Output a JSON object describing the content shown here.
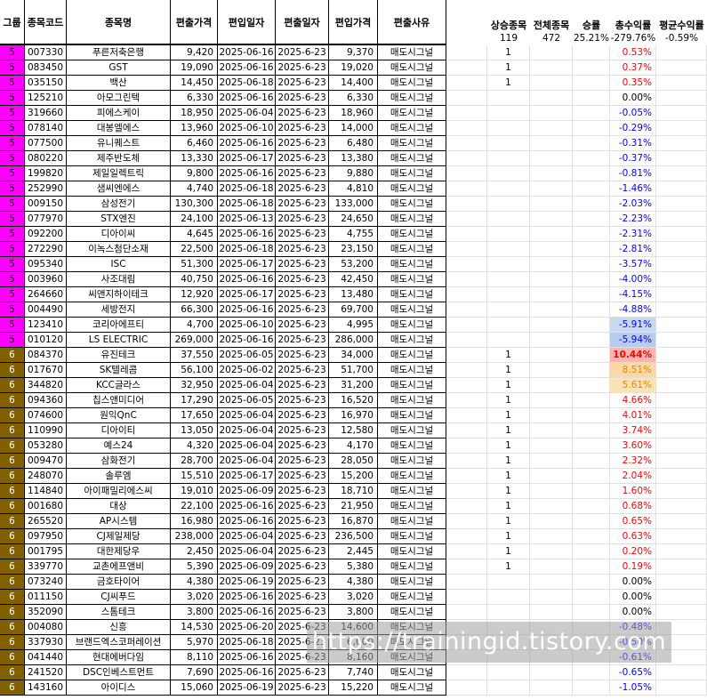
{
  "headers": [
    "그룹",
    "종목코드",
    "종목명",
    "편출가격",
    "편입일자",
    "편출일자",
    "편입가격",
    "편출사유"
  ],
  "summary": {
    "labels": [
      "상승종목",
      "전체종목",
      "승률",
      "총수익률",
      "평균수익률"
    ],
    "values": [
      "119",
      "472",
      "25.21%",
      "-279.76%",
      "-0.59%"
    ]
  },
  "colors": {
    "group5": "#ff00ff",
    "group6": "#806000",
    "negative": "#0000ff",
    "positive": "#ff0000"
  },
  "rows": [
    {
      "group": "5",
      "code": "007330",
      "name": "푸른저축은행",
      "out_price": "9,420",
      "in_date": "2025-06-16",
      "out_date": "2025-6-23",
      "in_price": "9,370",
      "reason": "매도시그널",
      "up": "1",
      "ret": "0.53%"
    },
    {
      "group": "5",
      "code": "083450",
      "name": "GST",
      "out_price": "19,090",
      "in_date": "2025-06-16",
      "out_date": "2025-6-23",
      "in_price": "19,020",
      "reason": "매도시그널",
      "up": "1",
      "ret": "0.37%"
    },
    {
      "group": "5",
      "code": "035150",
      "name": "백산",
      "out_price": "14,450",
      "in_date": "2025-06-18",
      "out_date": "2025-6-23",
      "in_price": "14,400",
      "reason": "매도시그널",
      "up": "1",
      "ret": "0.35%"
    },
    {
      "group": "5",
      "code": "125210",
      "name": "아모그린텍",
      "out_price": "6,330",
      "in_date": "2025-06-16",
      "out_date": "2025-6-23",
      "in_price": "6,330",
      "reason": "매도시그널",
      "up": "",
      "ret": "0.00%"
    },
    {
      "group": "5",
      "code": "319660",
      "name": "피에스케이",
      "out_price": "18,950",
      "in_date": "2025-06-04",
      "out_date": "2025-6-23",
      "in_price": "18,960",
      "reason": "매도시그널",
      "up": "",
      "ret": "-0.05%"
    },
    {
      "group": "5",
      "code": "078140",
      "name": "대봉엘에스",
      "out_price": "13,960",
      "in_date": "2025-06-10",
      "out_date": "2025-6-23",
      "in_price": "14,000",
      "reason": "매도시그널",
      "up": "",
      "ret": "-0.29%"
    },
    {
      "group": "5",
      "code": "077500",
      "name": "유니퀘스트",
      "out_price": "6,460",
      "in_date": "2025-06-16",
      "out_date": "2025-6-23",
      "in_price": "6,480",
      "reason": "매도시그널",
      "up": "",
      "ret": "-0.31%"
    },
    {
      "group": "5",
      "code": "080220",
      "name": "제주반도체",
      "out_price": "13,330",
      "in_date": "2025-06-17",
      "out_date": "2025-6-23",
      "in_price": "13,380",
      "reason": "매도시그널",
      "up": "",
      "ret": "-0.37%"
    },
    {
      "group": "5",
      "code": "199820",
      "name": "제일일렉트릭",
      "out_price": "9,800",
      "in_date": "2025-06-16",
      "out_date": "2025-6-23",
      "in_price": "9,880",
      "reason": "매도시그널",
      "up": "",
      "ret": "-0.81%"
    },
    {
      "group": "5",
      "code": "252990",
      "name": "샘씨엔에스",
      "out_price": "4,740",
      "in_date": "2025-06-18",
      "out_date": "2025-6-23",
      "in_price": "4,810",
      "reason": "매도시그널",
      "up": "",
      "ret": "-1.46%"
    },
    {
      "group": "5",
      "code": "009150",
      "name": "삼성전기",
      "out_price": "130,300",
      "in_date": "2025-06-18",
      "out_date": "2025-6-23",
      "in_price": "133,000",
      "reason": "매도시그널",
      "up": "",
      "ret": "-2.03%"
    },
    {
      "group": "5",
      "code": "077970",
      "name": "STX엔진",
      "out_price": "24,100",
      "in_date": "2025-06-13",
      "out_date": "2025-6-23",
      "in_price": "24,650",
      "reason": "매도시그널",
      "up": "",
      "ret": "-2.23%"
    },
    {
      "group": "5",
      "code": "092200",
      "name": "디아이씨",
      "out_price": "4,645",
      "in_date": "2025-06-16",
      "out_date": "2025-6-23",
      "in_price": "4,755",
      "reason": "매도시그널",
      "up": "",
      "ret": "-2.31%"
    },
    {
      "group": "5",
      "code": "272290",
      "name": "이녹스첨단소재",
      "out_price": "22,500",
      "in_date": "2025-06-18",
      "out_date": "2025-6-23",
      "in_price": "23,150",
      "reason": "매도시그널",
      "up": "",
      "ret": "-2.81%"
    },
    {
      "group": "5",
      "code": "095340",
      "name": "ISC",
      "out_price": "51,300",
      "in_date": "2025-06-17",
      "out_date": "2025-6-23",
      "in_price": "53,200",
      "reason": "매도시그널",
      "up": "",
      "ret": "-3.57%"
    },
    {
      "group": "5",
      "code": "003960",
      "name": "사조대림",
      "out_price": "40,750",
      "in_date": "2025-06-16",
      "out_date": "2025-6-23",
      "in_price": "42,450",
      "reason": "매도시그널",
      "up": "",
      "ret": "-4.00%"
    },
    {
      "group": "5",
      "code": "264660",
      "name": "씨앤지하이테크",
      "out_price": "12,920",
      "in_date": "2025-06-17",
      "out_date": "2025-6-23",
      "in_price": "13,480",
      "reason": "매도시그널",
      "up": "",
      "ret": "-4.15%"
    },
    {
      "group": "5",
      "code": "004490",
      "name": "세방전지",
      "out_price": "66,300",
      "in_date": "2025-06-16",
      "out_date": "2025-6-23",
      "in_price": "69,700",
      "reason": "매도시그널",
      "up": "",
      "ret": "-4.88%"
    },
    {
      "group": "5",
      "code": "123410",
      "name": "코리아에프티",
      "out_price": "4,700",
      "in_date": "2025-06-10",
      "out_date": "2025-6-23",
      "in_price": "4,995",
      "reason": "매도시그널",
      "up": "",
      "ret": "-5.91%",
      "hl": "#c9d9f2"
    },
    {
      "group": "5",
      "code": "010120",
      "name": "LS ELECTRIC",
      "out_price": "269,000",
      "in_date": "2025-06-16",
      "out_date": "2025-6-23",
      "in_price": "286,000",
      "reason": "매도시그널",
      "up": "",
      "ret": "-5.94%",
      "hl": "#b8cdee"
    },
    {
      "group": "6",
      "code": "084370",
      "name": "유진테크",
      "out_price": "37,550",
      "in_date": "2025-06-05",
      "out_date": "2025-6-23",
      "in_price": "34,000",
      "reason": "매도시그널",
      "up": "1",
      "ret": "10.44%",
      "hl": "#f8b7b3",
      "bold": true
    },
    {
      "group": "6",
      "code": "017670",
      "name": "SK텔레콤",
      "out_price": "56,100",
      "in_date": "2025-06-02",
      "out_date": "2025-6-23",
      "in_price": "51,700",
      "reason": "매도시그널",
      "up": "1",
      "ret": "8.51%",
      "hl": "#fbd9a6",
      "orange": true
    },
    {
      "group": "6",
      "code": "344820",
      "name": "KCC글라스",
      "out_price": "32,950",
      "in_date": "2025-06-04",
      "out_date": "2025-6-23",
      "in_price": "31,200",
      "reason": "매도시그널",
      "up": "1",
      "ret": "5.61%",
      "hl": "#fde2b6",
      "orange": true
    },
    {
      "group": "6",
      "code": "094360",
      "name": "칩스앤미디어",
      "out_price": "17,290",
      "in_date": "2025-06-05",
      "out_date": "2025-6-23",
      "in_price": "16,520",
      "reason": "매도시그널",
      "up": "1",
      "ret": "4.66%"
    },
    {
      "group": "6",
      "code": "074600",
      "name": "원익QnC",
      "out_price": "17,650",
      "in_date": "2025-06-04",
      "out_date": "2025-6-23",
      "in_price": "16,970",
      "reason": "매도시그널",
      "up": "1",
      "ret": "4.01%"
    },
    {
      "group": "6",
      "code": "110990",
      "name": "디아이티",
      "out_price": "13,050",
      "in_date": "2025-06-04",
      "out_date": "2025-6-23",
      "in_price": "12,580",
      "reason": "매도시그널",
      "up": "1",
      "ret": "3.74%"
    },
    {
      "group": "6",
      "code": "053280",
      "name": "예스24",
      "out_price": "4,320",
      "in_date": "2025-06-04",
      "out_date": "2025-6-23",
      "in_price": "4,170",
      "reason": "매도시그널",
      "up": "1",
      "ret": "3.60%"
    },
    {
      "group": "6",
      "code": "009470",
      "name": "삼화전기",
      "out_price": "28,700",
      "in_date": "2025-06-04",
      "out_date": "2025-6-23",
      "in_price": "28,050",
      "reason": "매도시그널",
      "up": "1",
      "ret": "2.32%"
    },
    {
      "group": "6",
      "code": "248070",
      "name": "솔루엠",
      "out_price": "15,510",
      "in_date": "2025-06-17",
      "out_date": "2025-6-23",
      "in_price": "15,200",
      "reason": "매도시그널",
      "up": "1",
      "ret": "2.04%"
    },
    {
      "group": "6",
      "code": "114840",
      "name": "아이패밀리에스씨",
      "out_price": "19,010",
      "in_date": "2025-06-09",
      "out_date": "2025-6-23",
      "in_price": "18,710",
      "reason": "매도시그널",
      "up": "1",
      "ret": "1.60%"
    },
    {
      "group": "6",
      "code": "001680",
      "name": "대상",
      "out_price": "22,100",
      "in_date": "2025-06-16",
      "out_date": "2025-6-23",
      "in_price": "21,950",
      "reason": "매도시그널",
      "up": "1",
      "ret": "0.68%"
    },
    {
      "group": "6",
      "code": "265520",
      "name": "AP시스템",
      "out_price": "16,980",
      "in_date": "2025-06-16",
      "out_date": "2025-6-23",
      "in_price": "16,870",
      "reason": "매도시그널",
      "up": "1",
      "ret": "0.65%"
    },
    {
      "group": "6",
      "code": "097950",
      "name": "CJ제일제당",
      "out_price": "238,000",
      "in_date": "2025-06-04",
      "out_date": "2025-6-23",
      "in_price": "236,500",
      "reason": "매도시그널",
      "up": "1",
      "ret": "0.63%"
    },
    {
      "group": "6",
      "code": "001795",
      "name": "대한제당우",
      "out_price": "2,450",
      "in_date": "2025-06-04",
      "out_date": "2025-6-23",
      "in_price": "2,445",
      "reason": "매도시그널",
      "up": "1",
      "ret": "0.20%"
    },
    {
      "group": "6",
      "code": "339770",
      "name": "교촌에프앤비",
      "out_price": "5,390",
      "in_date": "2025-06-09",
      "out_date": "2025-6-23",
      "in_price": "5,380",
      "reason": "매도시그널",
      "up": "1",
      "ret": "0.19%"
    },
    {
      "group": "6",
      "code": "073240",
      "name": "금호타이어",
      "out_price": "4,380",
      "in_date": "2025-06-19",
      "out_date": "2025-6-23",
      "in_price": "4,380",
      "reason": "매도시그널",
      "up": "",
      "ret": "0.00%"
    },
    {
      "group": "6",
      "code": "011150",
      "name": "CJ씨푸드",
      "out_price": "3,020",
      "in_date": "2025-06-16",
      "out_date": "2025-6-23",
      "in_price": "3,020",
      "reason": "매도시그널",
      "up": "",
      "ret": "0.00%"
    },
    {
      "group": "6",
      "code": "352090",
      "name": "스톰테크",
      "out_price": "3,800",
      "in_date": "2025-06-16",
      "out_date": "2025-6-23",
      "in_price": "3,800",
      "reason": "매도시그널",
      "up": "",
      "ret": "0.00%"
    },
    {
      "group": "6",
      "code": "004080",
      "name": "신흥",
      "out_price": "14,530",
      "in_date": "2025-06-20",
      "out_date": "2025-6-23",
      "in_price": "14,600",
      "reason": "매도시그널",
      "up": "",
      "ret": "-0.48%"
    },
    {
      "group": "6",
      "code": "337930",
      "name": "브랜드엑스코퍼레이션",
      "out_price": "5,970",
      "in_date": "2025-06-18",
      "out_date": "2025-6-23",
      "in_price": "6,000",
      "reason": "매도시그널",
      "up": "",
      "ret": "-0.50%"
    },
    {
      "group": "6",
      "code": "041440",
      "name": "현대에버다임",
      "out_price": "8,110",
      "in_date": "2025-06-16",
      "out_date": "2025-6-23",
      "in_price": "8,160",
      "reason": "매도시그널",
      "up": "",
      "ret": "-0.61%"
    },
    {
      "group": "6",
      "code": "241520",
      "name": "DSC인베스트먼트",
      "out_price": "7,690",
      "in_date": "2025-06-16",
      "out_date": "2025-6-23",
      "in_price": "7,740",
      "reason": "매도시그널",
      "up": "",
      "ret": "-0.65%"
    },
    {
      "group": "6",
      "code": "143160",
      "name": "아이디스",
      "out_price": "15,060",
      "in_date": "2025-06-19",
      "out_date": "2025-6-23",
      "in_price": "15,220",
      "reason": "매도시그널",
      "up": "",
      "ret": "-1.05%"
    }
  ],
  "watermark": "https://trainingid.tistory.com"
}
